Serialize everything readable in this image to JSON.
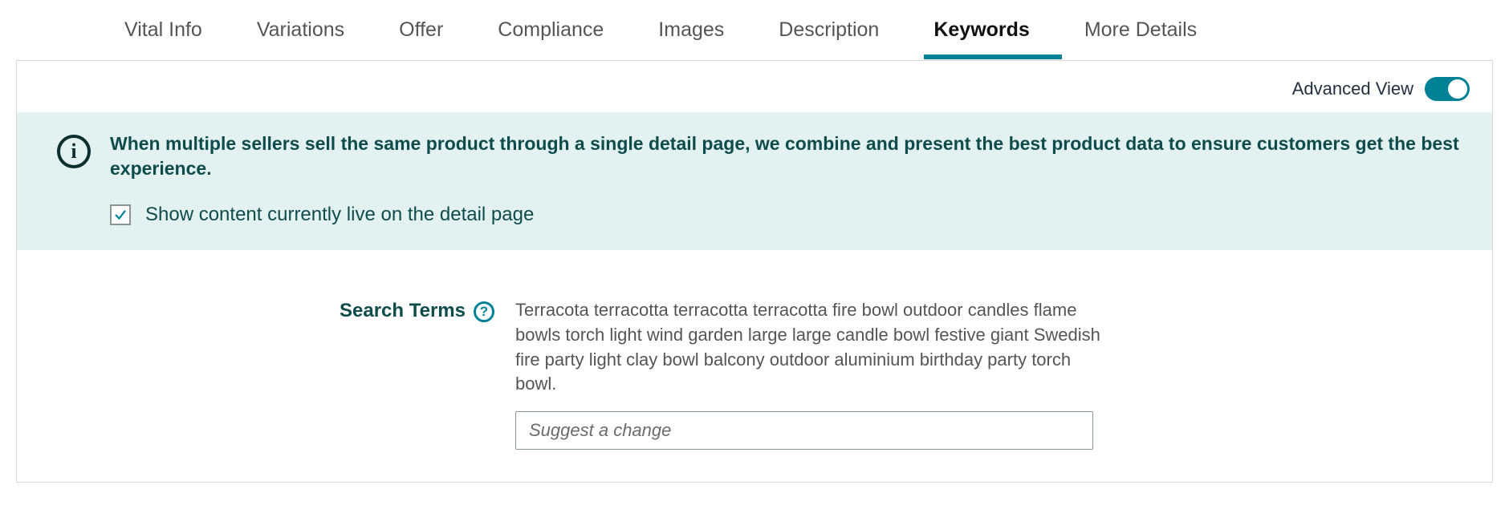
{
  "tabs": [
    {
      "label": "Vital Info"
    },
    {
      "label": "Variations"
    },
    {
      "label": "Offer"
    },
    {
      "label": "Compliance"
    },
    {
      "label": "Images"
    },
    {
      "label": "Description"
    },
    {
      "label": "Keywords"
    },
    {
      "label": "More Details"
    }
  ],
  "activeTabIndex": 6,
  "toolbar": {
    "advanced_view_label": "Advanced View",
    "advanced_view_on": true
  },
  "banner": {
    "message": "When multiple sellers sell the same product through a single detail page, we combine and present the best product data to ensure customers get the best experience.",
    "checkbox_checked": true,
    "checkbox_label": "Show content currently live on the detail page"
  },
  "form": {
    "search_terms": {
      "label": "Search Terms",
      "value": "Terracota terracotta terracotta terracotta fire bowl outdoor candles flame bowls torch light wind garden large large candle bowl festive giant Swedish fire party light clay bowl balcony outdoor aluminium birthday party torch bowl.",
      "placeholder": "Suggest a change"
    }
  }
}
